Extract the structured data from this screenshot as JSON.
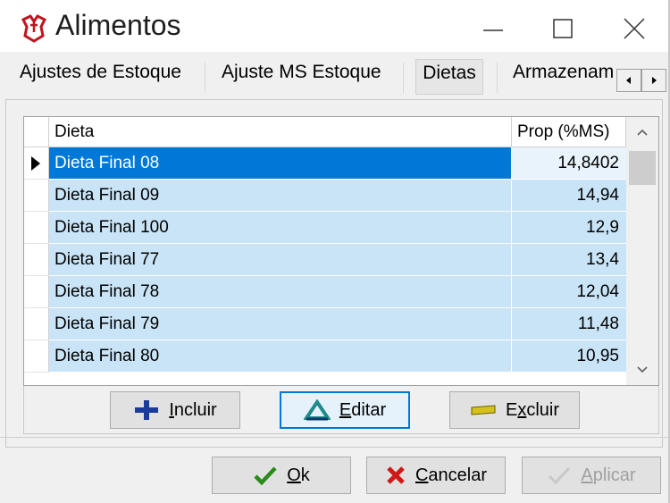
{
  "window": {
    "title": "Alimentos"
  },
  "tabs": [
    {
      "label": "Ajustes de Estoque"
    },
    {
      "label": "Ajuste MS Estoque"
    },
    {
      "label": "Dietas"
    },
    {
      "label": "Armazenam"
    }
  ],
  "grid": {
    "columns": [
      "Dieta",
      "Prop (%MS)"
    ],
    "rows": [
      {
        "dieta": "Dieta Final 08",
        "prop": "14,8402"
      },
      {
        "dieta": "Dieta Final 09",
        "prop": "14,94"
      },
      {
        "dieta": "Dieta Final 100",
        "prop": "12,9"
      },
      {
        "dieta": "Dieta Final 77",
        "prop": "13,4"
      },
      {
        "dieta": "Dieta Final 78",
        "prop": "12,04"
      },
      {
        "dieta": "Dieta Final 79",
        "prop": "11,48"
      },
      {
        "dieta": "Dieta Final 80",
        "prop": "10,95"
      }
    ]
  },
  "grid_buttons": {
    "incluir": {
      "first": "I",
      "rest": "ncluir"
    },
    "editar": {
      "first": "E",
      "rest": "ditar"
    },
    "excluir": {
      "first": "E",
      "mid": "x",
      "rest": "cluir"
    }
  },
  "dialog_buttons": {
    "ok": {
      "first": "O",
      "rest": "k"
    },
    "cancelar": {
      "first": "C",
      "rest": "ancelar"
    },
    "aplicar": {
      "first": "A",
      "rest": "plicar"
    }
  },
  "colors": {
    "selection": "#0078d7",
    "row_bg": "#c9e4f6",
    "focus": "#0078d7"
  }
}
